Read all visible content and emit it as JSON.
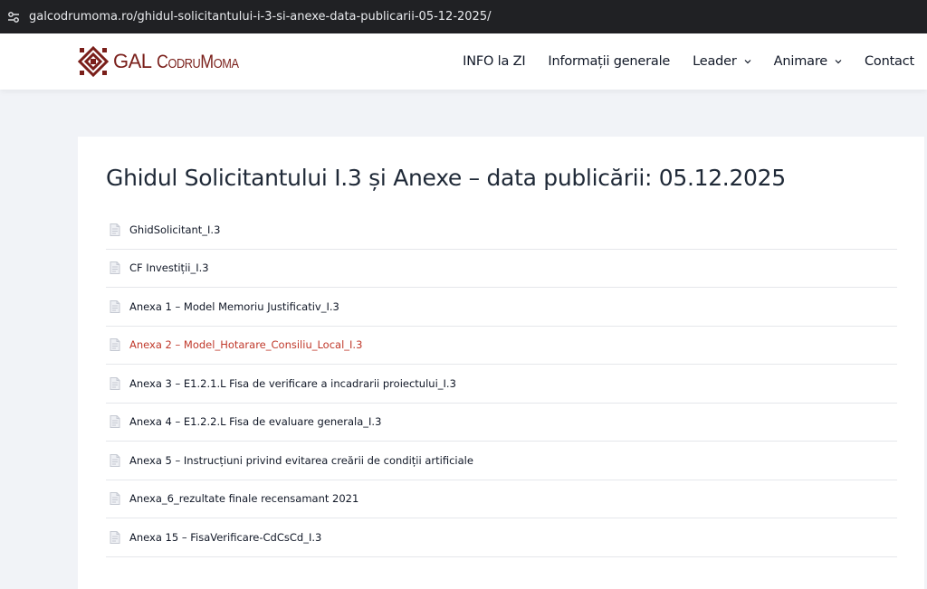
{
  "browser": {
    "url": "galcodrumoma.ro/ghidul-solicitantului-i-3-si-anexe-data-publicarii-05-12-2025/",
    "site_info_icon": "tune-icon"
  },
  "header": {
    "logo": {
      "gal": "GAL",
      "name": "CodruMoma",
      "icon": "ornament-logo-icon",
      "color": "#7a1f1a"
    },
    "nav": [
      {
        "label": "INFO la ZI",
        "dropdown": false
      },
      {
        "label": "Informații generale",
        "dropdown": false
      },
      {
        "label": "Leader",
        "dropdown": true
      },
      {
        "label": "Animare",
        "dropdown": true
      },
      {
        "label": "Contact",
        "dropdown": false
      }
    ]
  },
  "page": {
    "title": "Ghidul Solicitantului I.3 și Anexe – data publicării: 05.12.2025",
    "files": [
      {
        "label": "GhidSolicitant_I.3",
        "highlighted": false
      },
      {
        "label": "CF Investiții_I.3",
        "highlighted": false
      },
      {
        "label": "Anexa 1 – Model Memoriu Justificativ_I.3",
        "highlighted": false
      },
      {
        "label": "Anexa 2 – Model_Hotarare_Consiliu_Local_I.3",
        "highlighted": true
      },
      {
        "label": "Anexa 3 – E1.2.1.L Fisa de verificare a incadrarii proiectului_I.3",
        "highlighted": false
      },
      {
        "label": "Anexa 4 – E1.2.2.L Fisa de evaluare generala_I.3",
        "highlighted": false
      },
      {
        "label": "Anexa 5 – Instrucțiuni privind evitarea creării de condiții artificiale",
        "highlighted": false
      },
      {
        "label": "Anexa_6_rezultate finale recensamant 2021",
        "highlighted": false
      },
      {
        "label": "Anexa 15 – FisaVerificare-CdCsCd_I.3",
        "highlighted": false
      }
    ],
    "file_icon": "document-icon",
    "highlight_color": "#c0392b"
  }
}
